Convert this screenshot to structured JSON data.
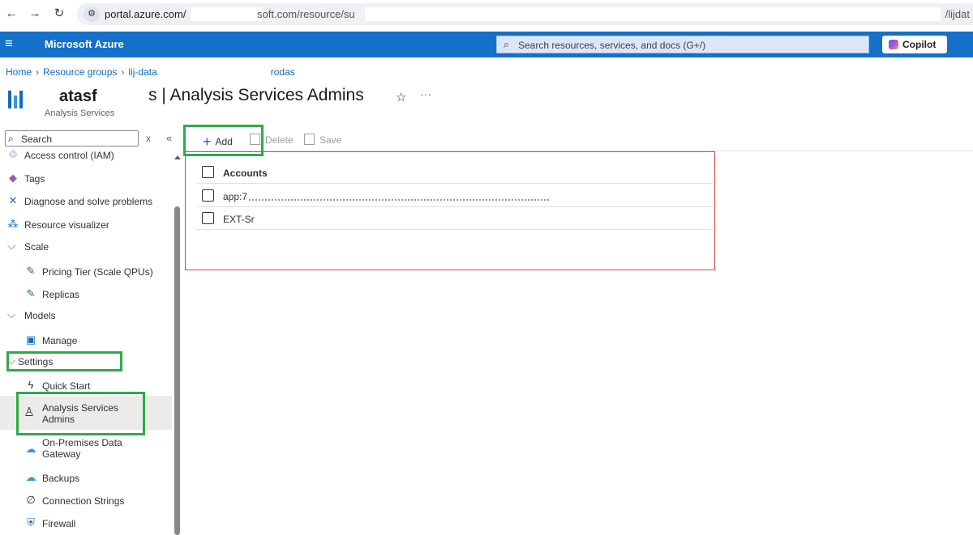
{
  "browser": {
    "back_icon": "arrow-left-icon",
    "forward_icon": "arrow-right-icon",
    "reload_icon": "reload-icon",
    "site_info_icon": "site-info-icon",
    "url_host": "portal.azure.com/",
    "url_middle": "soft.com/resource/su",
    "url_tail": "/lijdat"
  },
  "header": {
    "brand": "Microsoft Azure",
    "search_placeholder": "Search resources, services, and docs (G+/)",
    "copilot_label": "Copilot"
  },
  "breadcrumb": {
    "items": [
      "Home",
      "Resource groups",
      "lij-data",
      "rodas"
    ]
  },
  "page": {
    "title_left": "atasf",
    "title_right": "s | Analysis Services Admins",
    "subtitle": "Analysis Services",
    "favorite_icon": "star-icon",
    "more_label": "···"
  },
  "sidebar": {
    "search_placeholder": "Search",
    "clear_label": "x",
    "collapse_label": "«",
    "items": [
      {
        "label": "Access control (IAM)",
        "icon": "people-icon"
      },
      {
        "label": "Tags",
        "icon": "tag-icon"
      },
      {
        "label": "Diagnose and solve problems",
        "icon": "wrench-icon"
      },
      {
        "label": "Resource visualizer",
        "icon": "hierarchy-icon"
      },
      {
        "label": "Scale",
        "icon": "chevron-down-icon"
      },
      {
        "label": "Pricing Tier (Scale QPUs)",
        "icon": "edit-icon"
      },
      {
        "label": "Replicas",
        "icon": "edit-icon"
      },
      {
        "label": "Models",
        "icon": "chevron-down-icon"
      },
      {
        "label": "Manage",
        "icon": "database-icon"
      },
      {
        "label": "Settings",
        "icon": "chevron-down-icon"
      },
      {
        "label": "Quick Start",
        "icon": "lightning-icon"
      },
      {
        "label": "Analysis Services Admins",
        "label_line1": "Analysis Services",
        "label_line2": "Admins",
        "icon": "person-icon"
      },
      {
        "label": "On-Premises Data Gateway",
        "label_line1": "On-Premises Data",
        "label_line2": "Gateway",
        "icon": "cloud-gateway-icon"
      },
      {
        "label": "Backups",
        "icon": "cloud-icon"
      },
      {
        "label": "Connection Strings",
        "icon": "plug-icon"
      },
      {
        "label": "Firewall",
        "icon": "shield-icon"
      }
    ]
  },
  "toolbar": {
    "add_label": "Add",
    "delete_label": "Delete",
    "save_label": "Save"
  },
  "grid": {
    "header": "Accounts",
    "rows": [
      "app:7",
      "EXT-Sr"
    ]
  },
  "colors": {
    "azure_blue": "#1570c9",
    "highlight_green": "#2eaa47",
    "highlight_red": "#e0474c"
  }
}
